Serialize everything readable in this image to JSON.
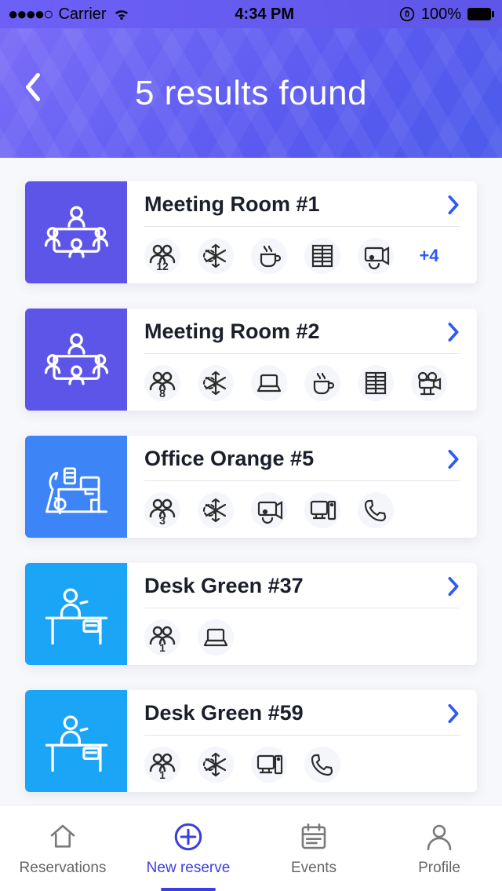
{
  "status": {
    "carrier": "Carrier",
    "time": "4:34 PM",
    "battery": "100%"
  },
  "header": {
    "title": "5 results found"
  },
  "results": [
    {
      "name": "Meeting Room #1",
      "capacity": "12",
      "more": "+4",
      "type": "meeting",
      "tint": "purple",
      "amenities": [
        "capacity",
        "climate",
        "coffee",
        "blinds",
        "projector"
      ]
    },
    {
      "name": "Meeting Room #2",
      "capacity": "8",
      "more": "",
      "type": "meeting",
      "tint": "purple",
      "amenities": [
        "capacity",
        "climate",
        "laptop",
        "coffee",
        "blinds",
        "camera"
      ]
    },
    {
      "name": "Office Orange #5",
      "capacity": "3",
      "more": "",
      "type": "office",
      "tint": "blue1",
      "amenities": [
        "capacity",
        "climate",
        "projector",
        "desktop",
        "phone"
      ]
    },
    {
      "name": "Desk Green #37",
      "capacity": "1",
      "more": "",
      "type": "desk",
      "tint": "blue2",
      "amenities": [
        "capacity",
        "laptop"
      ]
    },
    {
      "name": "Desk Green #59",
      "capacity": "1",
      "more": "",
      "type": "desk",
      "tint": "blue2",
      "amenities": [
        "capacity",
        "climate",
        "desktop",
        "phone"
      ]
    }
  ],
  "tabs": [
    {
      "label": "Reservations",
      "active": false
    },
    {
      "label": "New reserve",
      "active": true
    },
    {
      "label": "Events",
      "active": false
    },
    {
      "label": "Profile",
      "active": false
    }
  ]
}
